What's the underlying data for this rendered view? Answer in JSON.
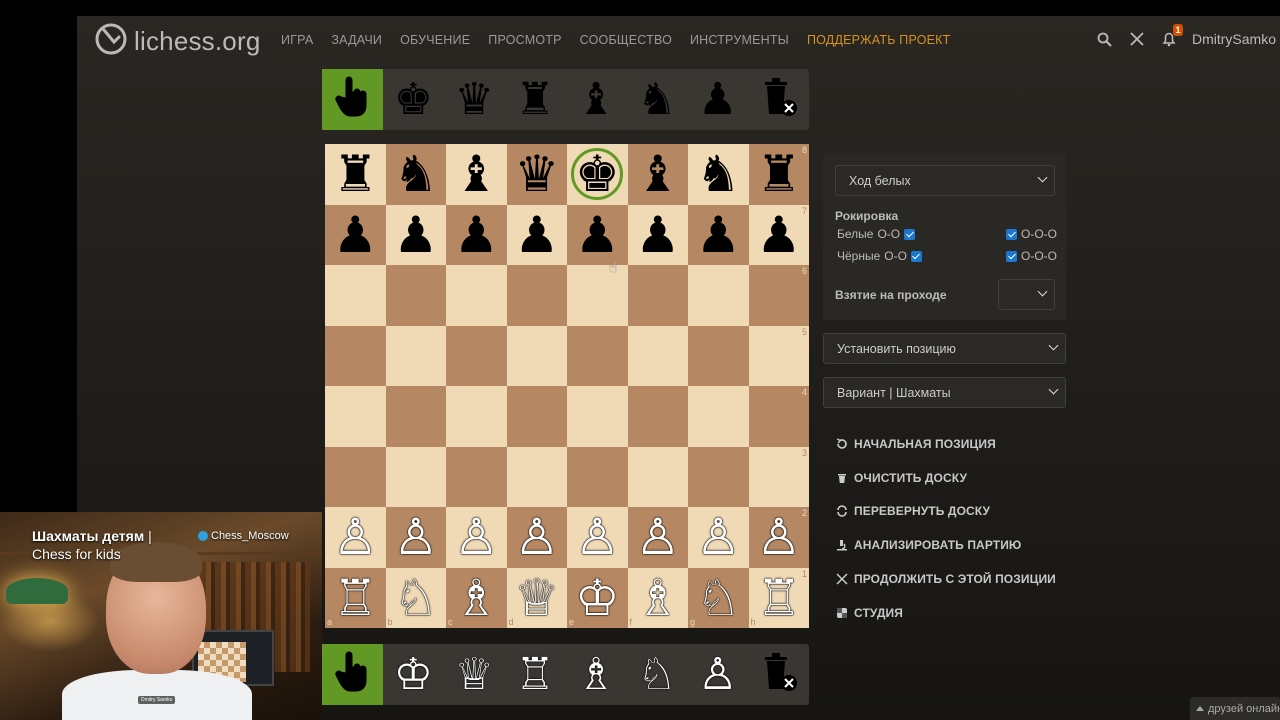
{
  "header": {
    "logo_text": "lichess.org",
    "nav": [
      "ИГРА",
      "ЗАДАЧИ",
      "ОБУЧЕНИЕ",
      "ПРОСМОТР",
      "СООБЩЕСТВО",
      "ИНСТРУМЕНТЫ"
    ],
    "support": "ПОДДЕРЖАТЬ ПРОЕКТ",
    "notifications_count": "1",
    "username": "DmitrySamko"
  },
  "spare_pieces": {
    "black": [
      "pointer-icon",
      "black-king",
      "black-queen",
      "black-rook",
      "black-bishop",
      "black-knight",
      "black-pawn",
      "trash-icon"
    ],
    "white": [
      "pointer-icon",
      "white-king",
      "white-queen",
      "white-rook",
      "white-bishop",
      "white-knight",
      "white-pawn",
      "trash-icon"
    ],
    "selected": "pointer"
  },
  "board": {
    "fen": "rnbqkbnr/pppppppp/8/8/8/8/PPPPPPPP/RNBQKBNR",
    "highlighted_square": "e8",
    "ranks": [
      "8",
      "7",
      "6",
      "5",
      "4",
      "3",
      "2",
      "1"
    ],
    "files": [
      "a",
      "b",
      "c",
      "d",
      "e",
      "f",
      "g",
      "h"
    ],
    "colors": {
      "light": "#f0d9b5",
      "dark": "#b58863",
      "accent": "#629924"
    }
  },
  "panel": {
    "turn_select": "Ход белых",
    "castling_title": "Рокировка",
    "white_label": "Белые",
    "black_label": "Чёрные",
    "short_castle": "O-O",
    "long_castle": "O-O-O",
    "castling": {
      "white_short": true,
      "white_long": true,
      "black_short": true,
      "black_long": true
    },
    "en_passant_label": "Взятие на проходе",
    "en_passant_value": "",
    "position_select": "Установить позицию",
    "variant_select": "Вариант | Шахматы"
  },
  "actions": [
    {
      "icon": "reset-icon",
      "label": "НАЧАЛЬНАЯ ПОЗИЦИЯ"
    },
    {
      "icon": "trash-icon",
      "label": "ОЧИСТИТЬ ДОСКУ"
    },
    {
      "icon": "flip-icon",
      "label": "ПЕРЕВЕРНУТЬ ДОСКУ"
    },
    {
      "icon": "microscope-icon",
      "label": "АНАЛИЗИРОВАТЬ ПАРТИЮ"
    },
    {
      "icon": "swords-icon",
      "label": "ПРОДОЛЖИТЬ С ЭТОЙ ПОЗИЦИИ"
    },
    {
      "icon": "study-icon",
      "label": "СТУДИЯ"
    }
  ],
  "webcam": {
    "title": "Шахматы детям",
    "separator": "|",
    "subtitle": "Chess for kids",
    "channel": "Chess_Moscow",
    "name_tag": "Dmitry Samko"
  },
  "friends_bar": "друзей онлайн"
}
